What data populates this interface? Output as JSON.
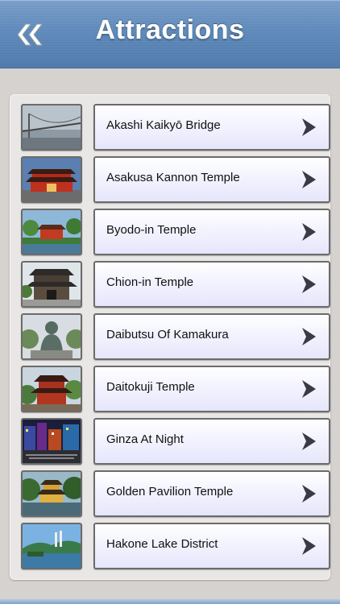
{
  "header": {
    "title": "Attractions",
    "back_icon": "double-chevron-left-icon",
    "color": "#5f8bbd"
  },
  "list": {
    "items": [
      {
        "label": "Akashi Kaikyō Bridge",
        "thumbnail": "bridge-photo"
      },
      {
        "label": "Asakusa Kannon Temple",
        "thumbnail": "red-temple-gate-photo"
      },
      {
        "label": "Byodo-in Temple",
        "thumbnail": "red-temple-photo"
      },
      {
        "label": "Chion-in Temple",
        "thumbnail": "temple-gate-photo"
      },
      {
        "label": "Daibutsu Of Kamakura",
        "thumbnail": "great-buddha-photo"
      },
      {
        "label": "Daitokuji Temple",
        "thumbnail": "pagoda-photo"
      },
      {
        "label": "Ginza At Night",
        "thumbnail": "city-night-photo"
      },
      {
        "label": "Golden Pavilion Temple",
        "thumbnail": "golden-pavilion-photo"
      },
      {
        "label": "Hakone Lake District",
        "thumbnail": "lake-photo"
      }
    ],
    "chevron_icon": "chevron-right-icon"
  }
}
